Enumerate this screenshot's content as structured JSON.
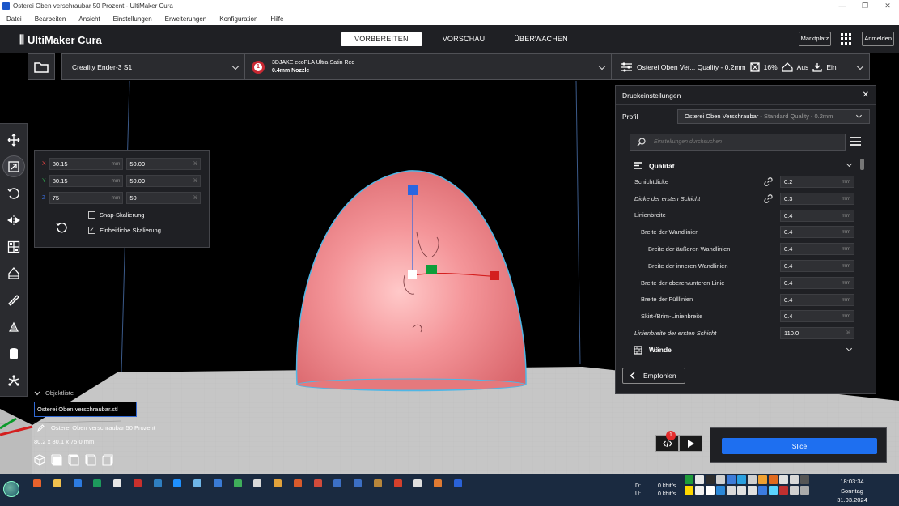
{
  "window": {
    "title": "Osterei Oben verschraubar 50 Prozent - UltiMaker Cura",
    "controls": [
      "—",
      "❐",
      "✕"
    ]
  },
  "menu": [
    "Datei",
    "Bearbeiten",
    "Ansicht",
    "Einstellungen",
    "Erweiterungen",
    "Konfiguration",
    "Hilfe"
  ],
  "header": {
    "logo": "UltiMaker Cura",
    "stages": [
      "VORBEREITEN",
      "VORSCHAU",
      "ÜBERWACHEN"
    ],
    "marketplace": "Marktplatz",
    "signin": "Anmelden"
  },
  "printer": {
    "machine": "Creality Ender-3 S1",
    "material_badge": "1",
    "material": "3DJAKE ecoPLA Ultra-Satin Red",
    "nozzle": "0.4mm Nozzle",
    "profile_summary": "Osterei Oben Ver... Quality - 0.2mm",
    "infill": "16%",
    "support": "Aus",
    "adhesion": "Ein"
  },
  "scale": {
    "x": {
      "axis": "X",
      "mm": "80.15",
      "pct": "50.09",
      "unit_mm": "mm",
      "unit_pct": "%"
    },
    "y": {
      "axis": "Y",
      "mm": "80.15",
      "pct": "50.09",
      "unit_mm": "mm",
      "unit_pct": "%"
    },
    "z": {
      "axis": "Z",
      "mm": "75",
      "pct": "50",
      "unit_mm": "mm",
      "unit_pct": "%"
    },
    "snap": "Snap-Skalierung",
    "snap_checked": false,
    "uniform": "Einheitliche Skalierung",
    "uniform_checked": true
  },
  "objects": {
    "header": "Objektliste",
    "items": [
      "Osterei Oben verschraubar.stl"
    ],
    "job_name": "Osterei Oben verschraubar 50 Prozent",
    "dimensions": "80.2 x 80.1 x 75.0 mm"
  },
  "settings": {
    "title": "Druckeinstellungen",
    "profile_label": "Profil",
    "profile_name": "Osterei Oben Verschraubar",
    "profile_detail": " - Standard Quality - 0.2mm",
    "search_placeholder": "Einstellungen durchsuchen",
    "category_quality": "Qualität",
    "category_walls": "Wände",
    "rows": [
      {
        "label": "Schichtdicke",
        "value": "0.2",
        "unit": "mm",
        "indent": 0,
        "italic": false,
        "link": true
      },
      {
        "label": "Dicke der ersten Schicht",
        "value": "0.3",
        "unit": "mm",
        "indent": 0,
        "italic": true,
        "link": true
      },
      {
        "label": "Linienbreite",
        "value": "0.4",
        "unit": "mm",
        "indent": 0,
        "italic": false,
        "link": false
      },
      {
        "label": "Breite der Wandlinien",
        "value": "0.4",
        "unit": "mm",
        "indent": 1,
        "italic": false,
        "link": false
      },
      {
        "label": "Breite der äußeren Wandlinien",
        "value": "0.4",
        "unit": "mm",
        "indent": 2,
        "italic": false,
        "link": false
      },
      {
        "label": "Breite der inneren Wandlinien",
        "value": "0.4",
        "unit": "mm",
        "indent": 2,
        "italic": false,
        "link": false
      },
      {
        "label": "Breite der oberen/unteren Linie",
        "value": "0.4",
        "unit": "mm",
        "indent": 1,
        "italic": false,
        "link": false
      },
      {
        "label": "Breite der Fülllinien",
        "value": "0.4",
        "unit": "mm",
        "indent": 1,
        "italic": false,
        "link": false
      },
      {
        "label": "Skirt-/Brim-Linienbreite",
        "value": "0.4",
        "unit": "mm",
        "indent": 1,
        "italic": false,
        "link": false
      },
      {
        "label": "Linienbreite der ersten Schicht",
        "value": "110.0",
        "unit": "%",
        "indent": 0,
        "italic": true,
        "link": false
      }
    ],
    "recommended": "Empfohlen"
  },
  "slice": {
    "badge": "1",
    "button": "Slice"
  },
  "taskbar": {
    "net_labels": [
      "D:",
      "U:"
    ],
    "net_values": [
      "0 kbit/s",
      "0 kbit/s"
    ],
    "time": "18:03:34",
    "day": "Sonntag",
    "date": "31.03.2024"
  },
  "colors": {
    "accent": "#1e6ff0",
    "model": "#f07f82",
    "material_red": "#c82832"
  }
}
